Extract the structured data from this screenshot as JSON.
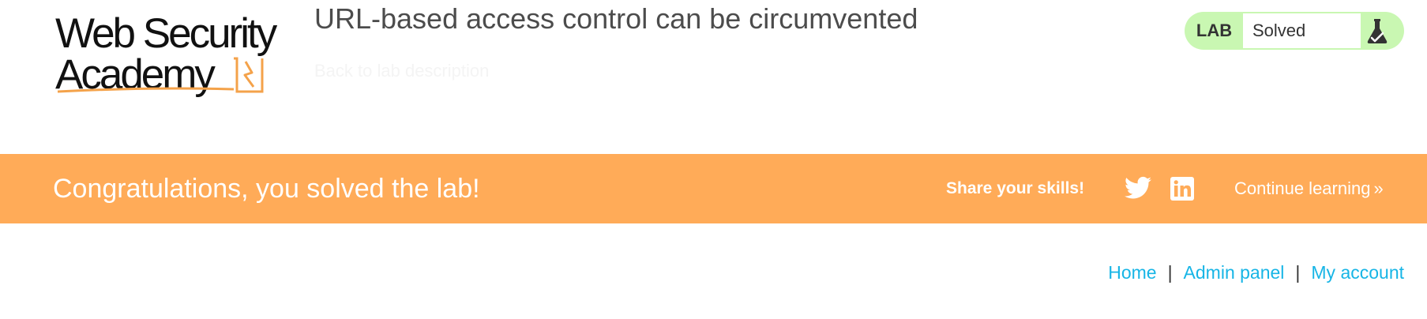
{
  "logo": {
    "line1": "Web Security",
    "line2": "Academy",
    "accent_color": "#f4a24a"
  },
  "lab": {
    "title": "URL-based access control can be circumvented",
    "back_link": "Back to lab description",
    "status_label": "LAB",
    "status_value": "Solved",
    "status_color": "#c9f7b2"
  },
  "banner": {
    "message": "Congratulations, you solved the lab!",
    "share_label": "Share your skills!",
    "continue_label": "Continue learning",
    "continue_chevron": "»",
    "background": "#ffab58",
    "icons": [
      "twitter-icon",
      "linkedin-icon"
    ]
  },
  "nav": {
    "home": "Home",
    "admin_panel": "Admin panel",
    "my_account": "My account",
    "separator": "|",
    "link_color": "#17b5e6"
  }
}
